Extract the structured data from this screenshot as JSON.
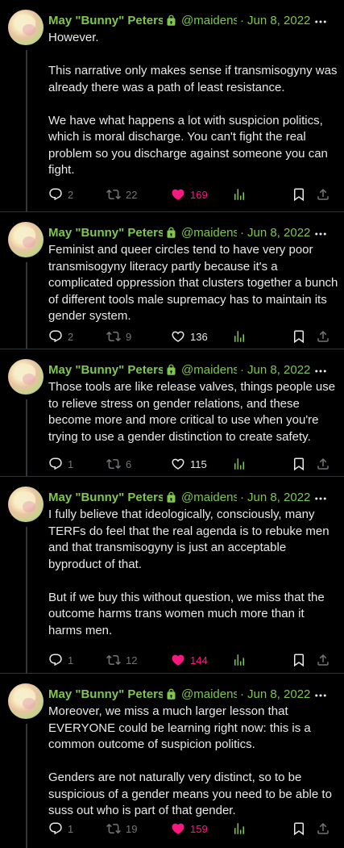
{
  "author": {
    "name": "May \"Bunny\" Peters",
    "handle": "@maidens",
    "protected_icon": "lock-icon",
    "avatar": "avatar-image"
  },
  "colors": {
    "name": "#7fc74f",
    "like_active": "#f91880",
    "muted": "#71767b",
    "text": "#e7e9ea",
    "background": "#000000"
  },
  "tweets": [
    {
      "date": "Jun 8, 2022",
      "paragraphs": [
        "However.",
        "This narrative only makes sense if transmisogyny was already there was a path of least resistance.",
        "We have what happens a lot with suspicion politics, which is moral discharge. You can't fight the real problem so you discharge against someone you can fight."
      ],
      "replies": "2",
      "retweets": "22",
      "likes": "169",
      "liked": true
    },
    {
      "date": "Jun 8, 2022",
      "paragraphs": [
        "Feminist and queer circles tend to have very poor transmisogyny literacy partly because it's a complicated oppression that clusters together a bunch of different tools male supremacy has to maintain its gender system."
      ],
      "replies": "2",
      "retweets": "9",
      "likes": "136",
      "liked": false
    },
    {
      "date": "Jun 8, 2022",
      "paragraphs": [
        "Those tools are like release valves, things people use to relieve stress on gender relations, and these become more and more critical to use when you're trying to use a gender distinction to create safety."
      ],
      "replies": "1",
      "retweets": "6",
      "likes": "115",
      "liked": false
    },
    {
      "date": "Jun 8, 2022",
      "paragraphs": [
        "I fully believe that ideologically, consciously, many TERFs do feel that the real agenda is to rebuke men and that transmisogyny is just an acceptable byproduct of that.",
        "But if we buy this without question, we miss that the outcome harms trans women much more than it harms men."
      ],
      "replies": "1",
      "retweets": "12",
      "likes": "144",
      "liked": true
    },
    {
      "date": "Jun 8, 2022",
      "paragraphs": [
        "Moreover, we miss a much larger lesson that EVERYONE could be learning right now: this is a common outcome of suspicion politics.",
        "Genders are not naturally very distinct, so to be suspicious of a gender means you need to be able to suss out who is part of that gender."
      ],
      "replies": "1",
      "retweets": "19",
      "likes": "159",
      "liked": true
    }
  ]
}
